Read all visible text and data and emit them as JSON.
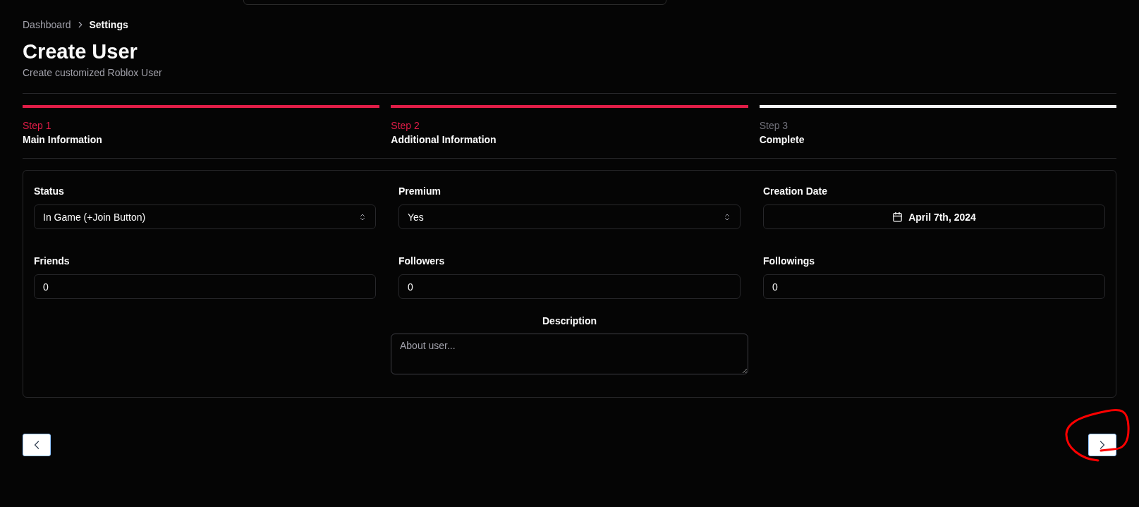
{
  "breadcrumb": [
    {
      "label": "Dashboard",
      "current": false
    },
    {
      "label": "Settings",
      "current": true
    }
  ],
  "header": {
    "title": "Create User",
    "subtitle": "Create customized Roblox User"
  },
  "steps": [
    {
      "label": "Step 1",
      "name": "Main Information",
      "done": true
    },
    {
      "label": "Step 2",
      "name": "Additional Information",
      "done": true
    },
    {
      "label": "Step 3",
      "name": "Complete",
      "done": false
    }
  ],
  "fields": [
    {
      "kind": "select",
      "label": "Status",
      "value": "In Game (+Join Button)"
    },
    {
      "kind": "select",
      "label": "Premium",
      "value": "Yes"
    },
    {
      "kind": "date",
      "label": "Creation Date",
      "value": "April 7th, 2024"
    },
    {
      "kind": "input",
      "label": "Friends",
      "value": "0"
    },
    {
      "kind": "input",
      "label": "Followers",
      "value": "0"
    },
    {
      "kind": "input",
      "label": "Followings",
      "value": "0"
    }
  ],
  "description": {
    "label": "Description",
    "placeholder": "About user..."
  },
  "navigation": {
    "back_disabled": false,
    "next_disabled": false,
    "next_circled": true
  }
}
